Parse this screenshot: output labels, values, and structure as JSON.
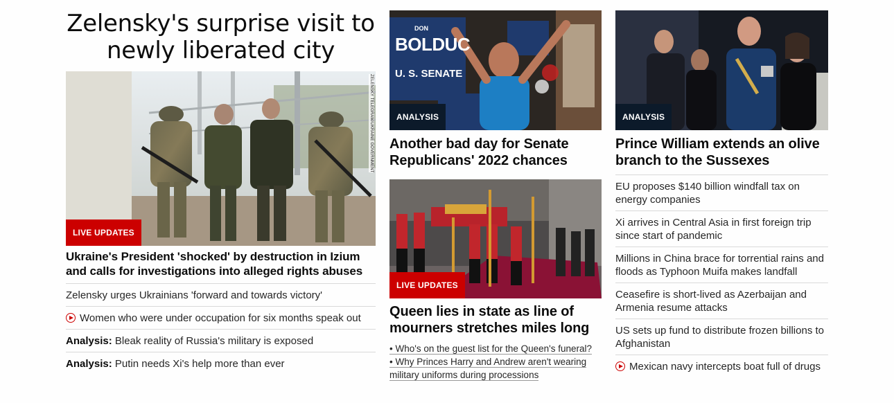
{
  "col1": {
    "hero_title": "Zelensky's surprise visit to newly liberated city",
    "image_credit": "ZELENSKY TELEGRAM/UKRAINE GOVERNMENT",
    "badge": "LIVE UPDATES",
    "headline": "Ukraine's President 'shocked' by destruction in Izium and calls for investigations into alleged rights abuses",
    "links": [
      {
        "text": "Zelensky urges Ukrainians 'forward and towards victory'"
      },
      {
        "text": "Women who were under occupation for six months speak out",
        "icon": "play-icon"
      },
      {
        "prefix": "Analysis:",
        "text": " Bleak reality of Russia's military is exposed"
      },
      {
        "prefix": "Analysis:",
        "text": " Putin needs Xi's help more than ever"
      }
    ]
  },
  "col2": {
    "story1": {
      "badge": "ANALYSIS",
      "sign_top": "DON",
      "sign_name": "BOLDUC",
      "sign_bottom": "U. S. SENATE",
      "headline": "Another bad day for Senate Republicans' 2022 chances"
    },
    "story2": {
      "badge": "LIVE UPDATES",
      "headline": "Queen lies in state as line of mourners stretches miles long",
      "bullets": [
        "• Who's on the guest list for the Queen's funeral?",
        "• Why Princes Harry and Andrew aren't wearing military uniforms during processions"
      ]
    }
  },
  "col3": {
    "badge": "ANALYSIS",
    "headline": "Prince William extends an olive branch to the Sussexes",
    "links": [
      {
        "text": "EU proposes $140 billion windfall tax on energy companies"
      },
      {
        "text": "Xi arrives in Central Asia in first foreign trip since start of pandemic"
      },
      {
        "text": "Millions in China brace for torrential rains and floods as Typhoon Muifa makes landfall"
      },
      {
        "text": "Ceasefire is short-lived as Azerbaijan and Armenia resume attacks"
      },
      {
        "text": "US sets up fund to distribute frozen billions to Afghanistan"
      },
      {
        "text": "Mexican navy intercepts boat full of drugs",
        "icon": "play-icon"
      }
    ]
  },
  "colors": {
    "live": "#cc0000",
    "analysis": "#0c1a2a",
    "text": "#0c0c0c"
  }
}
